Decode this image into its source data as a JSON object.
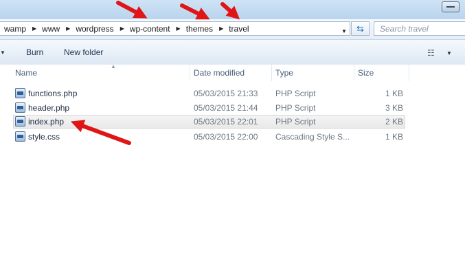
{
  "address": {
    "breadcrumb": [
      "wamp",
      "www",
      "wordpress",
      "wp-content",
      "themes",
      "travel"
    ],
    "search_placeholder": "Search travel"
  },
  "toolbar": {
    "burn_label": "Burn",
    "new_folder_label": "New folder"
  },
  "columns": {
    "name": "Name",
    "date_modified": "Date modified",
    "type": "Type",
    "size": "Size"
  },
  "files": [
    {
      "name": "functions.php",
      "date": "05/03/2015 21:33",
      "type": "PHP Script",
      "size": "1 KB"
    },
    {
      "name": "header.php",
      "date": "05/03/2015 21:44",
      "type": "PHP Script",
      "size": "3 KB"
    },
    {
      "name": "index.php",
      "date": "05/03/2015 22:01",
      "type": "PHP Script",
      "size": "2 KB",
      "selected": true
    },
    {
      "name": "style.css",
      "date": "05/03/2015 22:00",
      "type": "Cascading Style S...",
      "size": "1 KB"
    }
  ],
  "colors": {
    "arrow_red": "#e01616",
    "selection_gray": "#ececec",
    "link_blue": "#2f6fb3"
  },
  "icons": {
    "file": "php-file-icon",
    "refresh": "refresh-icon",
    "views": "views-icon"
  }
}
